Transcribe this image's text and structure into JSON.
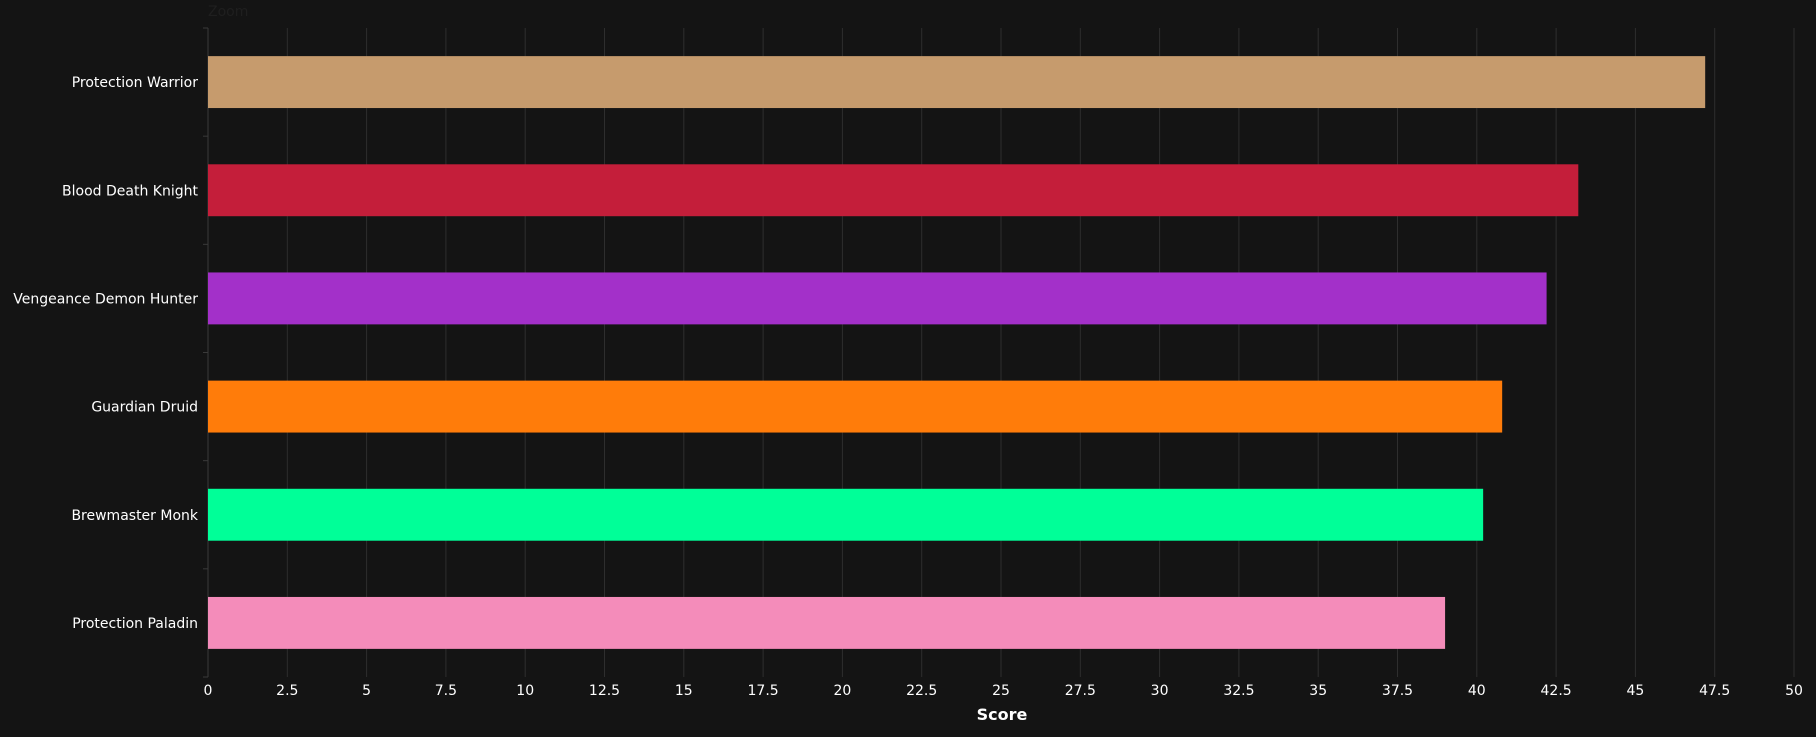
{
  "zoom_label": "Zoom",
  "chart_data": {
    "type": "bar",
    "orientation": "horizontal",
    "categories": [
      "Protection Warrior",
      "Blood Death Knight",
      "Vengeance Demon Hunter",
      "Guardian Druid",
      "Brewmaster Monk",
      "Protection Paladin"
    ],
    "values": [
      47.2,
      43.2,
      42.2,
      40.8,
      40.2,
      39.0
    ],
    "colors": [
      "#c69b6d",
      "#c41e3a",
      "#a330c9",
      "#ff7c0a",
      "#00ff98",
      "#f48cba"
    ],
    "xlabel": "Score",
    "ylabel": "",
    "xlim": [
      0,
      50
    ],
    "x_ticks": [
      "0",
      "2.5",
      "5",
      "7.5",
      "10",
      "12.5",
      "15",
      "17.5",
      "20",
      "22.5",
      "25",
      "27.5",
      "30",
      "32.5",
      "35",
      "37.5",
      "40",
      "42.5",
      "45",
      "47.5",
      "50"
    ],
    "grid": true,
    "legend": "none"
  }
}
